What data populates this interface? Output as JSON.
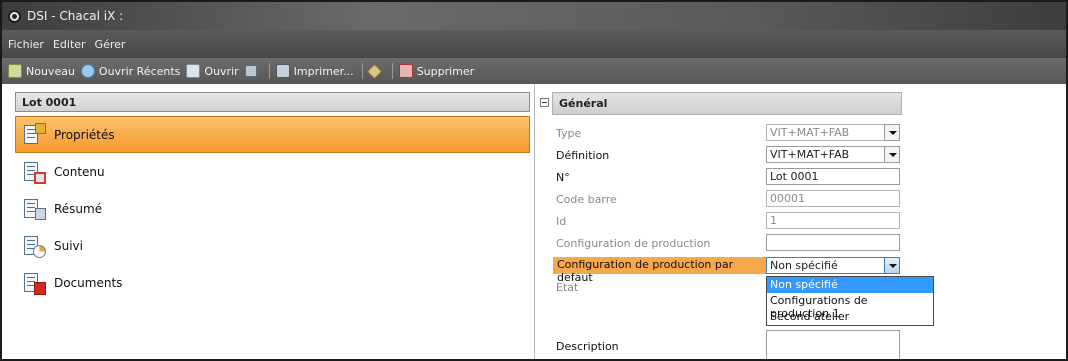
{
  "window": {
    "title": "DSI - Chacal iX :"
  },
  "menu": {
    "items": [
      "Fichier",
      "Editer",
      "Gérer"
    ]
  },
  "toolbar": {
    "new_label": "Nouveau",
    "recent_label": "Ouvrir Récents",
    "open_label": "Ouvrir",
    "print_label": "Imprimer...",
    "delete_label": "Supprimer"
  },
  "left": {
    "header": "Lot 0001",
    "nav": [
      {
        "label": "Propriétés",
        "icon": "properties-icon",
        "active": true
      },
      {
        "label": "Contenu",
        "icon": "content-icon",
        "active": false
      },
      {
        "label": "Résumé",
        "icon": "summary-icon",
        "active": false
      },
      {
        "label": "Suivi",
        "icon": "tracking-icon",
        "active": false
      },
      {
        "label": "Documents",
        "icon": "documents-icon",
        "active": false
      }
    ]
  },
  "right": {
    "section_title": "Général",
    "fields": {
      "type": {
        "label": "Type",
        "value": "VIT+MAT+FAB"
      },
      "definition": {
        "label": "Définition",
        "value": "VIT+MAT+FAB"
      },
      "number": {
        "label": "N°",
        "value": "Lot 0001"
      },
      "barcode": {
        "label": "Code barre",
        "value": "00001"
      },
      "id": {
        "label": "Id",
        "value": "1"
      },
      "prod_config": {
        "label": "Configuration de production",
        "value": ""
      },
      "default_prod_config": {
        "label": "Configuration de production par defaut",
        "value": "Non spécifié"
      },
      "state": {
        "label": "Etat"
      },
      "description": {
        "label": "Description",
        "value": ""
      }
    },
    "dropdown_options": [
      "Non spécifié",
      "Configurations de production 1",
      "Second atelier"
    ]
  },
  "colors": {
    "accent": "#f49a2a",
    "selection": "#3399ff"
  }
}
